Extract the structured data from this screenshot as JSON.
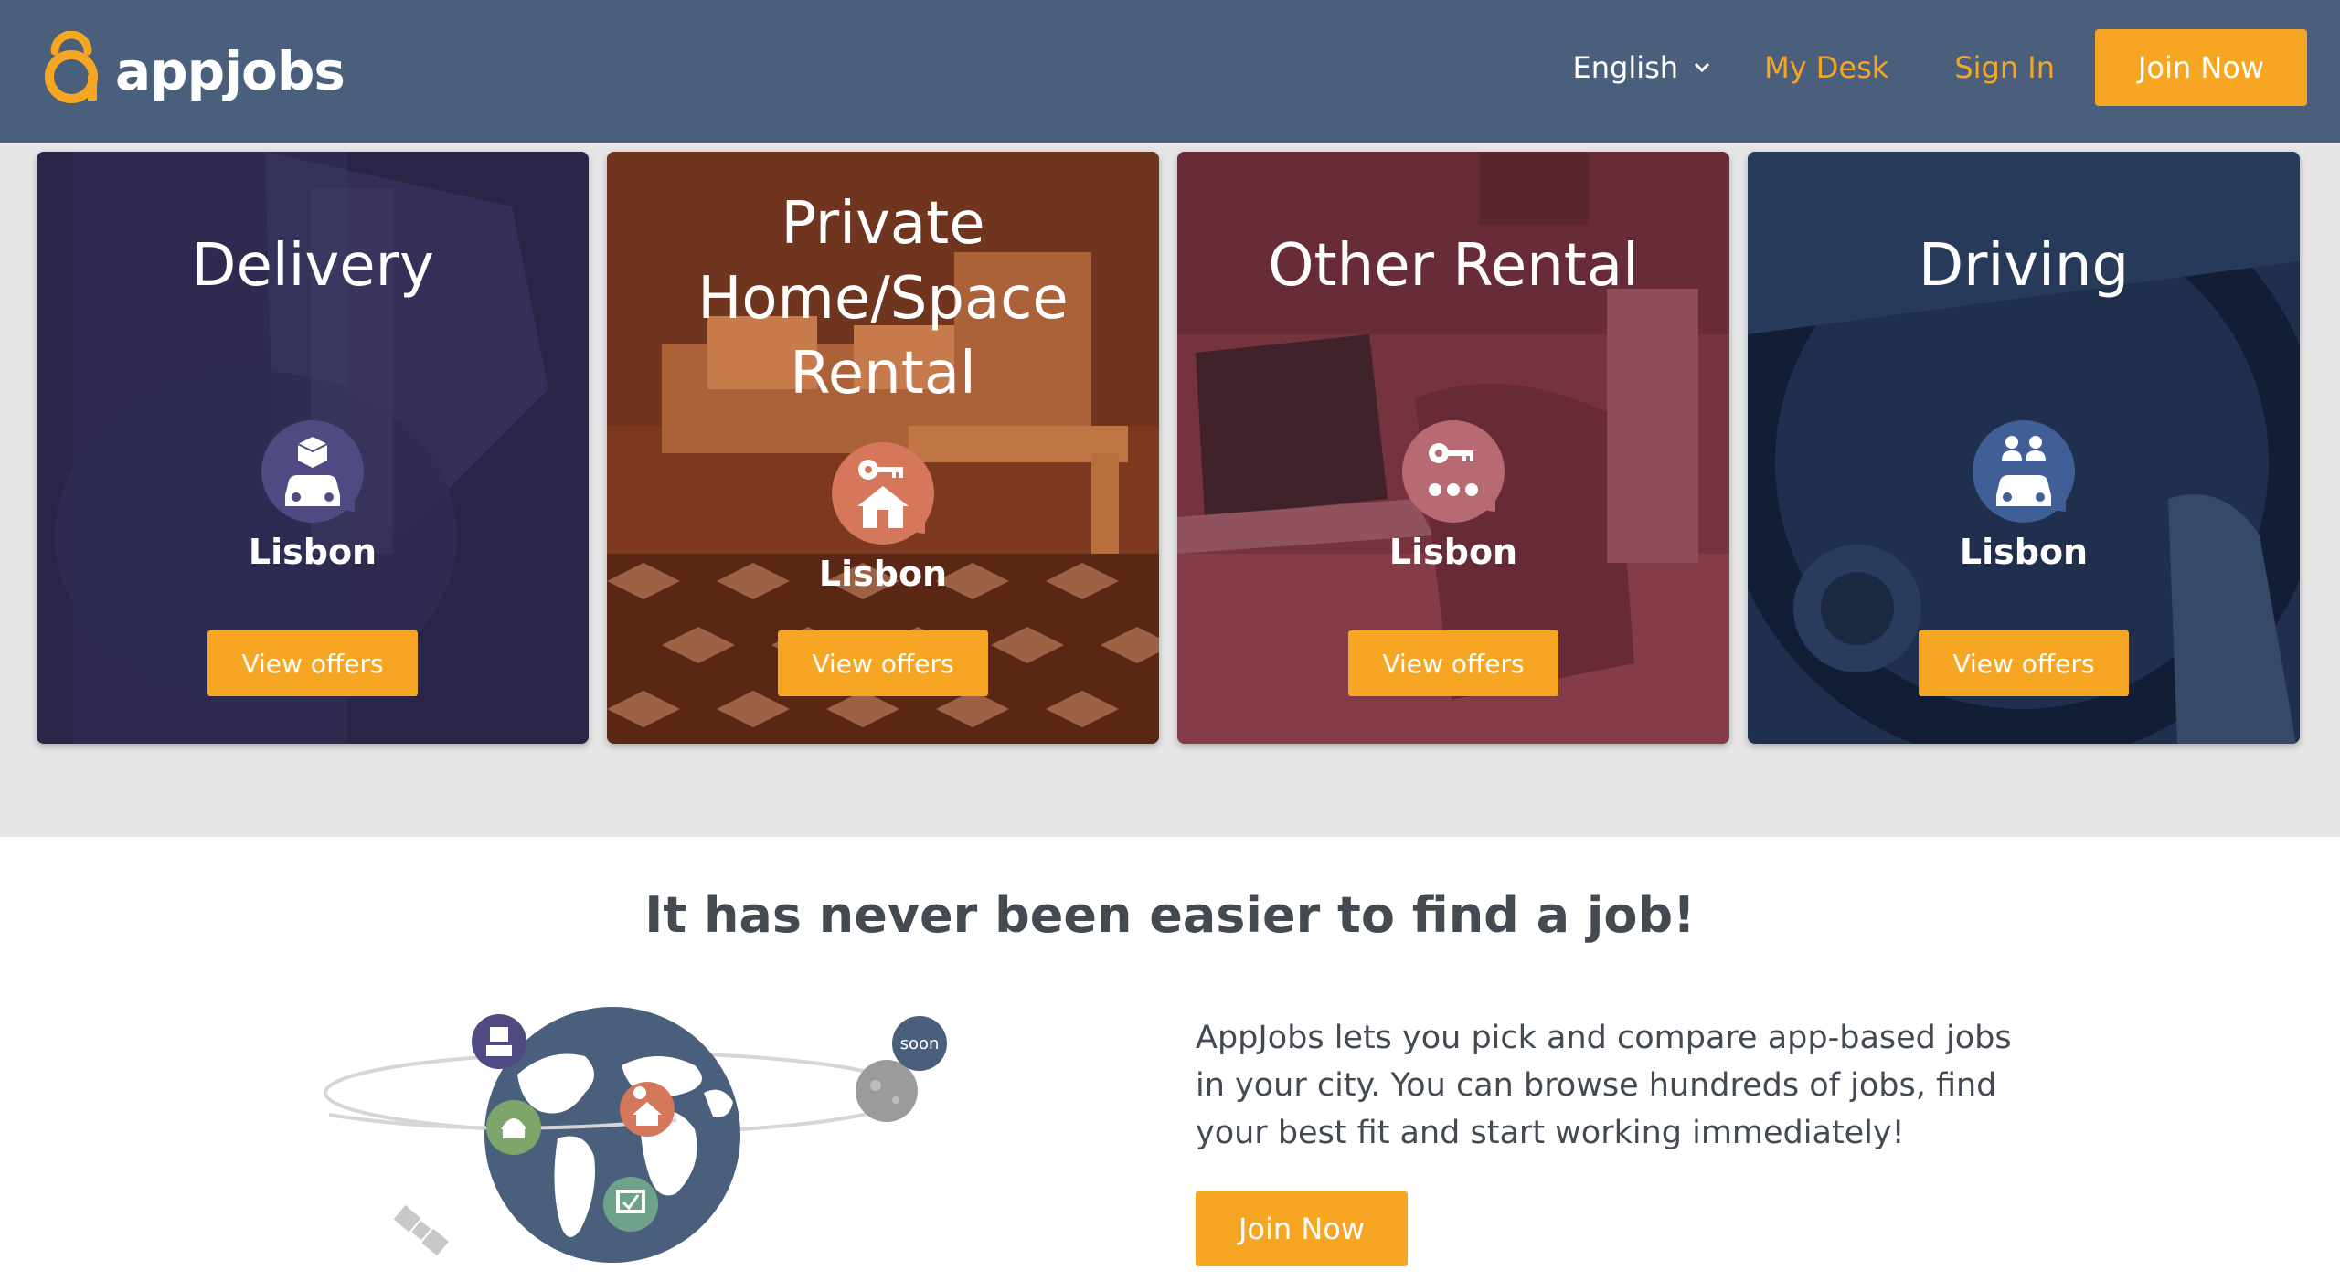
{
  "header": {
    "logo_text": "appjobs",
    "language": "English",
    "my_desk": "My Desk",
    "sign_in": "Sign In",
    "join_now": "Join Now"
  },
  "cards": [
    {
      "title": "Delivery",
      "city": "Lisbon",
      "button": "View offers",
      "icon": "delivery-icon",
      "icon_color": "#4f4a82"
    },
    {
      "title": "Private Home/Space Rental",
      "city": "Lisbon",
      "button": "View offers",
      "icon": "home-rental-icon",
      "icon_color": "#d4775a"
    },
    {
      "title": "Other Rental",
      "city": "Lisbon",
      "button": "View offers",
      "icon": "other-rental-icon",
      "icon_color": "#b76a72"
    },
    {
      "title": "Driving",
      "city": "Lisbon",
      "button": "View offers",
      "icon": "driving-icon",
      "icon_color": "#3f5f96"
    }
  ],
  "lower": {
    "title": "It has never been easier to find a job!",
    "description": "AppJobs lets you pick and compare app-based jobs in your city. You can browse hundreds of jobs, find your best fit and start working immediately!",
    "join_now": "Join Now",
    "soon_badge": "soon"
  },
  "colors": {
    "header_bg": "#4a5f7b",
    "accent": "#f6a623",
    "text_dark": "#444a52"
  }
}
